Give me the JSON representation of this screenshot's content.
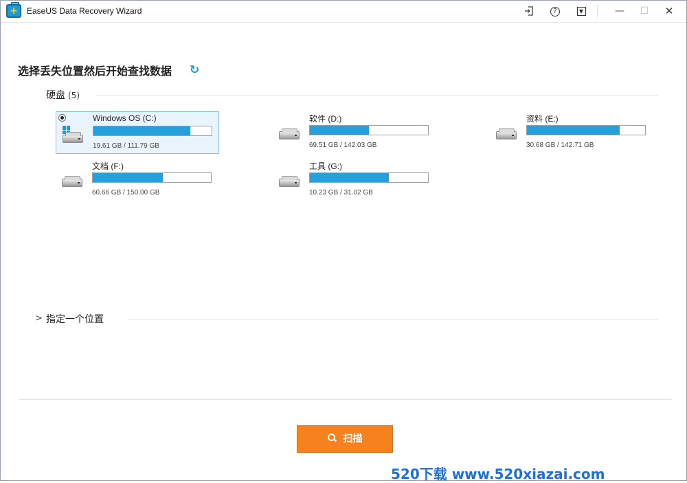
{
  "titlebar": {
    "app_title": "EaseUS Data Recovery Wizard",
    "icons": [
      "sign-in-icon",
      "help-icon",
      "menu-icon"
    ],
    "window_buttons": [
      "minimize",
      "maximize",
      "close"
    ]
  },
  "main": {
    "title": "选择丢失位置然后开始查找数据",
    "disks_section": {
      "label": "硬盘",
      "count": "(5)"
    },
    "drives": [
      {
        "name": "Windows OS (C:)",
        "size_text": "19.61 GB / 111.79 GB",
        "used_fraction": 0.82,
        "selected": true,
        "os": true
      },
      {
        "name": "软件 (D:)",
        "size_text": "69.51 GB / 142.03 GB",
        "used_fraction": 0.5,
        "selected": false
      },
      {
        "name": "资料 (E:)",
        "size_text": "30.68 GB / 142.71 GB",
        "used_fraction": 0.785,
        "selected": false
      },
      {
        "name": "文档 (F:)",
        "size_text": "60.66 GB / 150.00 GB",
        "used_fraction": 0.595,
        "selected": false
      },
      {
        "name": "工具 (G:)",
        "size_text": "10.23 GB / 31.02 GB",
        "used_fraction": 0.67,
        "selected": false
      }
    ],
    "location_section": {
      "label": "指定一个位置"
    }
  },
  "footer": {
    "scan_label": "扫描"
  },
  "watermark": {
    "text": "520下载 www.520xiazai.com"
  },
  "colors": {
    "accent": "#26a0da",
    "scan_button": "#f6821f",
    "selected_bg": "#e9f4fd",
    "watermark": "#1f6fd6"
  }
}
